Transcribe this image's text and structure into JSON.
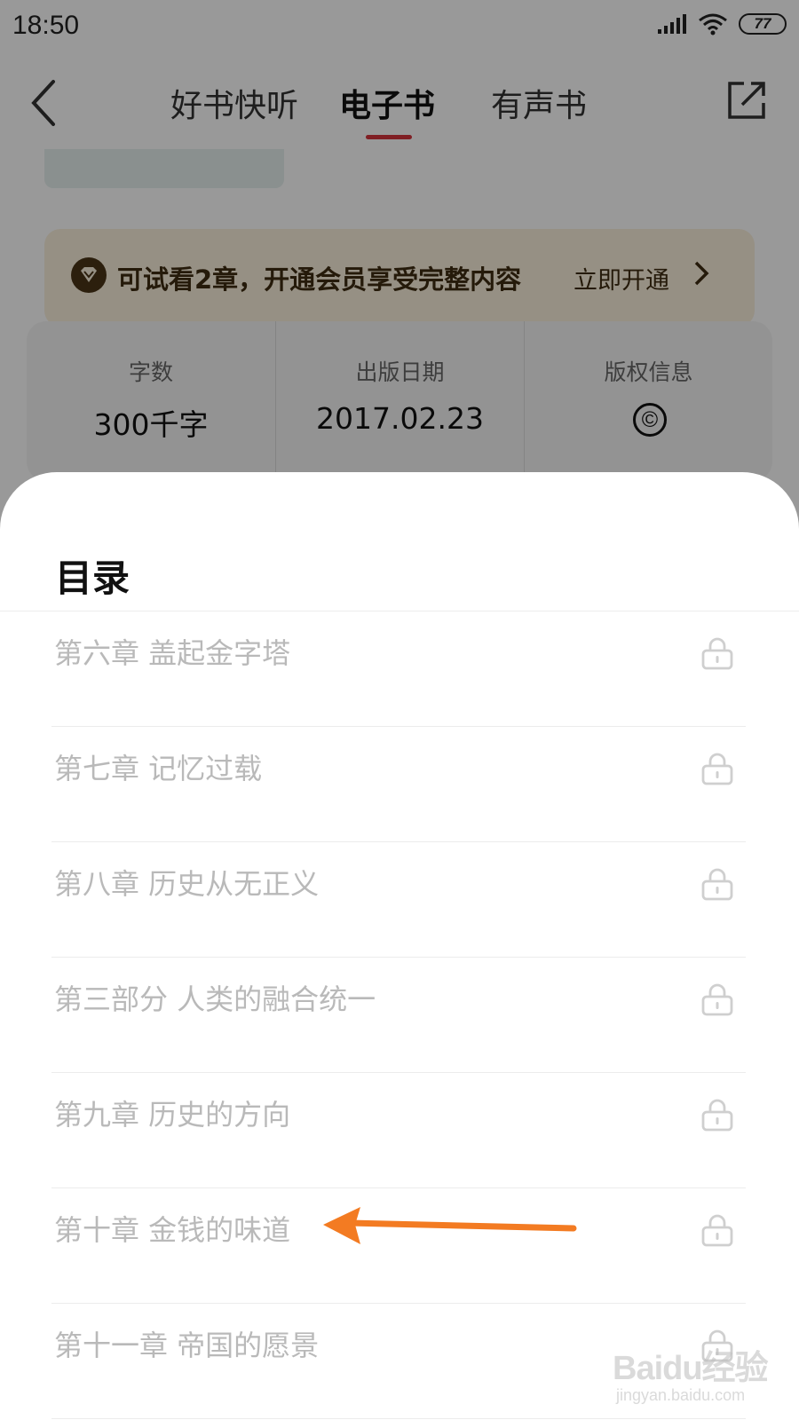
{
  "status_bar": {
    "time": "18:50",
    "battery": "77"
  },
  "nav": {
    "tabs": [
      {
        "label": "好书快听",
        "active": false
      },
      {
        "label": "电子书",
        "active": true
      },
      {
        "label": "有声书",
        "active": false
      }
    ],
    "accent_color": "#d5343d"
  },
  "vip_banner": {
    "text": "可试看2章，开通会员享受完整内容",
    "link": "立即开通"
  },
  "book_info": [
    {
      "label": "字数",
      "value": "300千字"
    },
    {
      "label": "出版日期",
      "value": "2017.02.23"
    },
    {
      "label": "版权信息",
      "icon": "copyright-icon"
    }
  ],
  "toc": {
    "title": "目录",
    "items": [
      {
        "label": "第六章 盖起金字塔",
        "locked": true
      },
      {
        "label": "第七章 记忆过载",
        "locked": true
      },
      {
        "label": "第八章 历史从无正义",
        "locked": true
      },
      {
        "label": "第三部分 人类的融合统一",
        "locked": true
      },
      {
        "label": "第九章 历史的方向",
        "locked": true
      },
      {
        "label": "第十章 金钱的味道",
        "locked": true
      },
      {
        "label": "第十一章 帝国的愿景",
        "locked": true
      }
    ]
  },
  "annotation": {
    "color": "#f37b22",
    "target": "第十章 金钱的味道"
  },
  "watermark": {
    "main": "Baidu经验",
    "sub": "jingyan.baidu.com"
  }
}
